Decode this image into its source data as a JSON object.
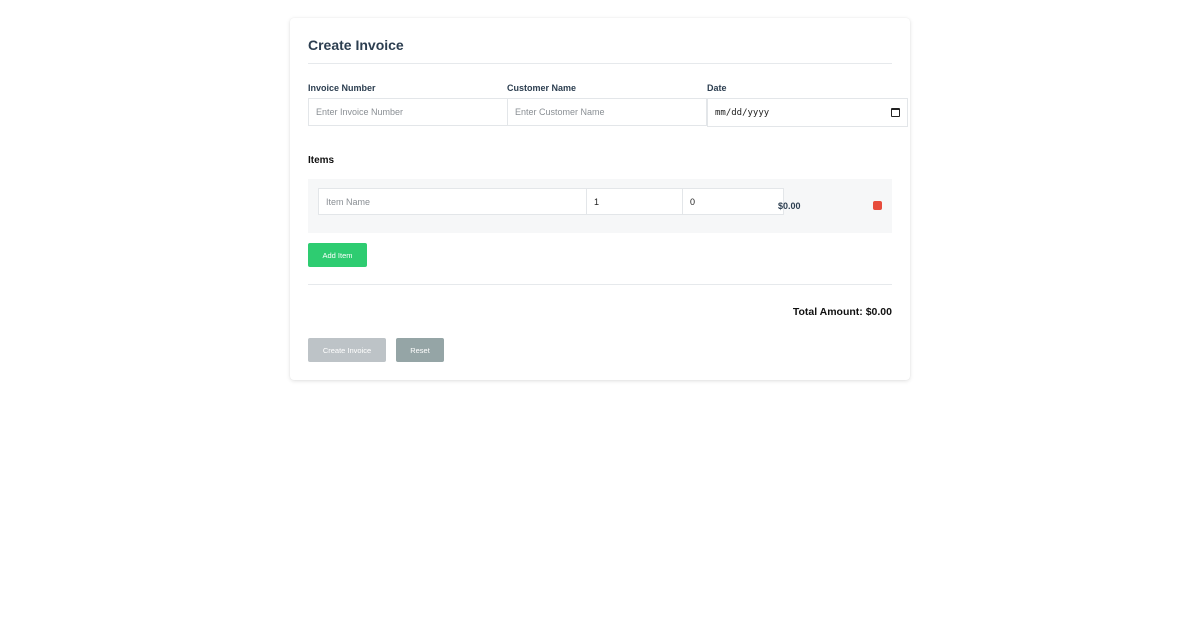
{
  "form": {
    "title": "Create Invoice",
    "fields": {
      "invoice_number": {
        "label": "Invoice Number",
        "placeholder": "Enter Invoice Number",
        "value": ""
      },
      "customer_name": {
        "label": "Customer Name",
        "placeholder": "Enter Customer Name",
        "value": ""
      },
      "date": {
        "label": "Date",
        "value": "mm/dd/yyyy"
      }
    }
  },
  "items": {
    "heading": "Items",
    "rows": [
      {
        "name_placeholder": "Item Name",
        "quantity": "1",
        "price": "0",
        "total": "$0.00"
      }
    ],
    "add_label": "Add Item"
  },
  "summary": {
    "total_text": "Total Amount: $0.00"
  },
  "actions": {
    "create_label": "Create Invoice",
    "reset_label": "Reset"
  },
  "colors": {
    "add_button": "#2ecc71",
    "remove_button": "#e74c3c",
    "create_button_disabled": "#bdc3c7",
    "reset_button": "#95a5a6",
    "heading_text": "#2c3e50"
  },
  "icons": {
    "date_picker": "calendar-icon",
    "remove_item": "delete-icon"
  }
}
